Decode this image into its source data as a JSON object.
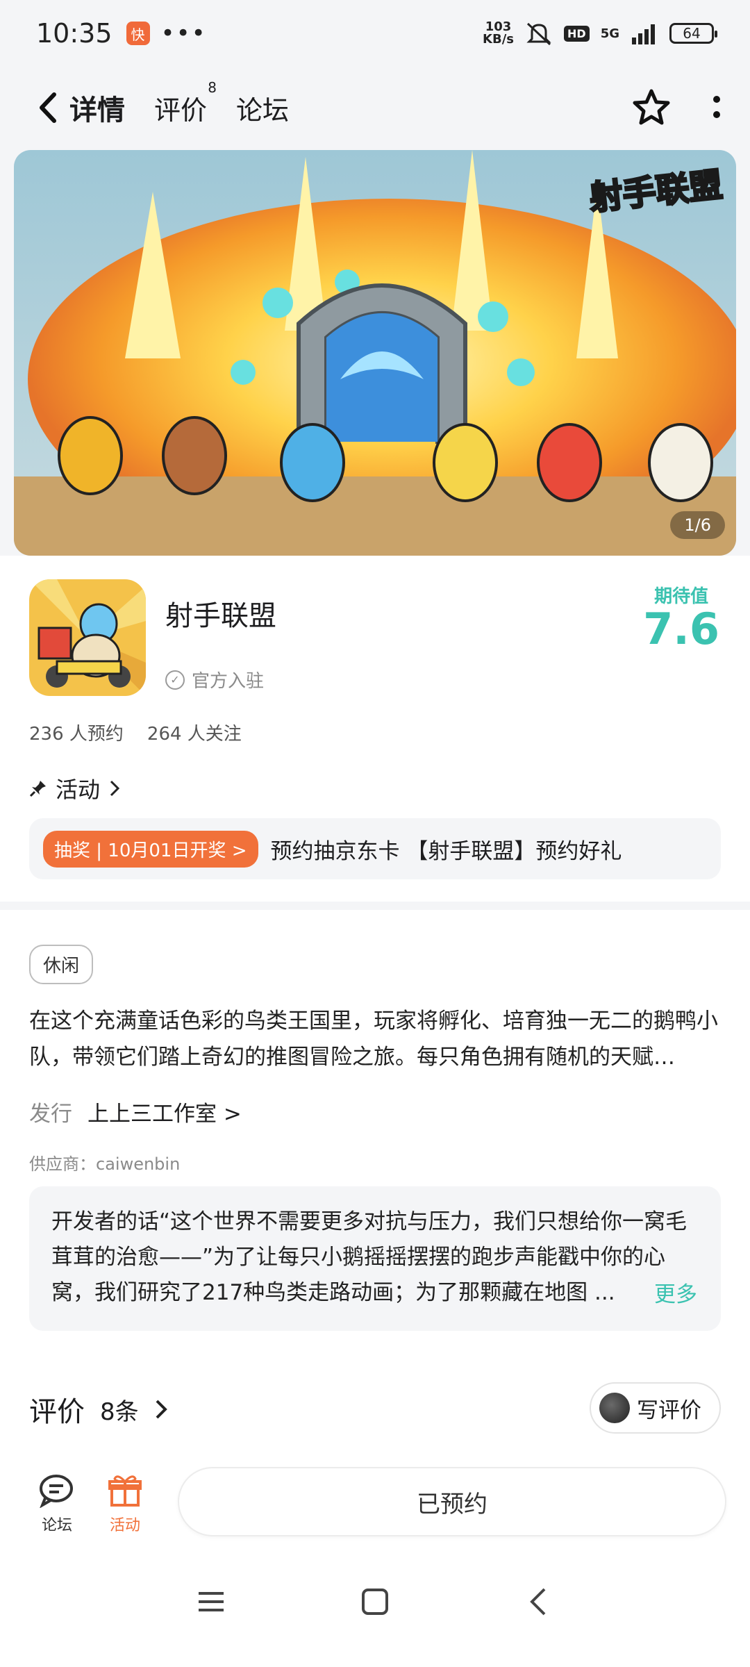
{
  "status_bar": {
    "time": "10:35",
    "notification_app": "快",
    "more": "•••",
    "speed_top": "103",
    "speed_bottom": "KB/s",
    "hd": "HD",
    "network": "5G",
    "battery": "64"
  },
  "nav": {
    "tabs": [
      {
        "label": "详情",
        "active": true
      },
      {
        "label": "评价",
        "badge": "8"
      },
      {
        "label": "论坛"
      }
    ]
  },
  "banner": {
    "logo_text": "射手联盟",
    "counter": "1/6"
  },
  "app": {
    "name": "射手联盟",
    "official": "官方入驻",
    "rating_label": "期待值",
    "rating_value": "7.6",
    "reservations": "236 人预约",
    "followers": "264 人关注"
  },
  "activity": {
    "title": "活动",
    "tag": "抽奖 | 10月01日开奖 >",
    "text": "预约抽京东卡 【射手联盟】预约好礼"
  },
  "description": {
    "genre": "休闲",
    "text": "在这个充满童话色彩的鸟类王国里，玩家将孵化、培育独一无二的鹅鸭小队，带领它们踏上奇幻的推图冒险之旅。每只角色拥有随机的天赋…",
    "publisher_key": "发行",
    "publisher_value": "上上三工作室 >",
    "supplier": "供应商：caiwenbin",
    "dev_note": "开发者的话“这个世界不需要更多对抗与压力，我们只想给你一窝毛茸茸的治愈——”为了让每只小鹅摇摇摆摆的跑步声能戳中你的心窝，我们研究了217种鸟类走路动画；为了那颗藏在地图 ...",
    "more": "更多"
  },
  "reviews": {
    "title": "评价",
    "count": "8条",
    "write": "写评价"
  },
  "bottom_bar": {
    "forum": "论坛",
    "activity": "活动",
    "reserved": "已预约"
  },
  "colors": {
    "accent": "#3bc2b0",
    "orange": "#f1713a"
  }
}
